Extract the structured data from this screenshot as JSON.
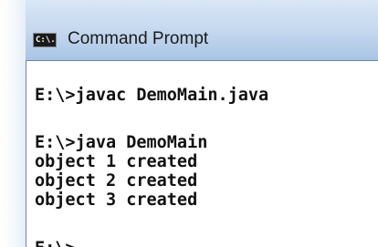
{
  "window": {
    "title": "Command Prompt",
    "icon_label": "C:\\."
  },
  "console": {
    "lines": [
      "E:\\>javac DemoMain.java",
      "E:\\>java DemoMain",
      "object 1 created",
      "object 2 created",
      "object 3 created",
      "E:\\>"
    ]
  }
}
